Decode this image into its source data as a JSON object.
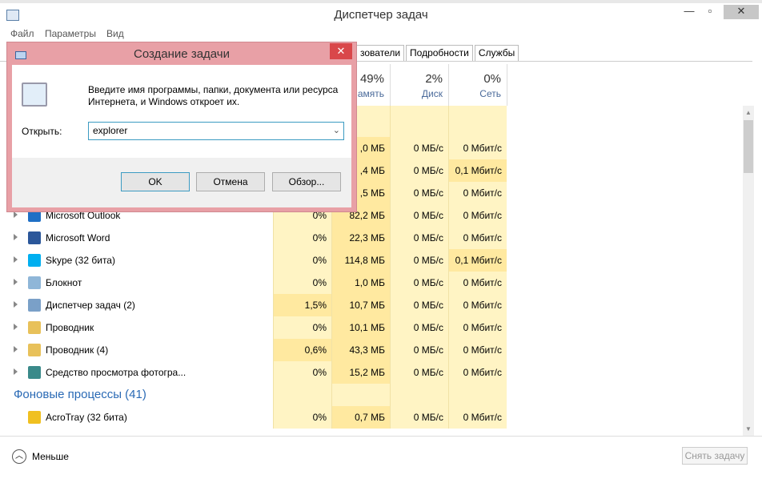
{
  "window": {
    "title": "Диспетчер задач",
    "minimize": "—",
    "maximize": "▫",
    "close": "✕"
  },
  "menu": [
    "Файл",
    "Параметры",
    "Вид"
  ],
  "tabs": [
    "зователи",
    "Подробности",
    "Службы"
  ],
  "columns": [
    {
      "pct": "",
      "label": ""
    },
    {
      "pct": "49%",
      "label": "амять"
    },
    {
      "pct": "2%",
      "label": "Диск"
    },
    {
      "pct": "0%",
      "label": "Сеть"
    }
  ],
  "rows": [
    {
      "name": "",
      "cpu": "",
      "mem": ",0 МБ",
      "disk": "0 МБ/с",
      "net": "0 Мбит/с"
    },
    {
      "name": "",
      "cpu": "",
      "mem": ",4 МБ",
      "disk": "0 МБ/с",
      "net": "0,1 Мбит/с"
    },
    {
      "name": "",
      "cpu": "",
      "mem": ",5 МБ",
      "disk": "0 МБ/с",
      "net": "0 Мбит/с"
    },
    {
      "name": "Microsoft Outlook",
      "cpu": "0%",
      "mem": "82,2 МБ",
      "disk": "0 МБ/с",
      "net": "0 Мбит/с",
      "color": "#1f6fc5"
    },
    {
      "name": "Microsoft Word",
      "cpu": "0%",
      "mem": "22,3 МБ",
      "disk": "0 МБ/с",
      "net": "0 Мбит/с",
      "color": "#2b579a"
    },
    {
      "name": "Skype (32 бита)",
      "cpu": "0%",
      "mem": "114,8 МБ",
      "disk": "0 МБ/с",
      "net": "0,1 Мбит/с",
      "color": "#00aff0"
    },
    {
      "name": "Блокнот",
      "cpu": "0%",
      "mem": "1,0 МБ",
      "disk": "0 МБ/с",
      "net": "0 Мбит/с",
      "color": "#8fb6d8"
    },
    {
      "name": "Диспетчер задач (2)",
      "cpu": "1,5%",
      "mem": "10,7 МБ",
      "disk": "0 МБ/с",
      "net": "0 Мбит/с",
      "color": "#7aa0c8"
    },
    {
      "name": "Проводник",
      "cpu": "0%",
      "mem": "10,1 МБ",
      "disk": "0 МБ/с",
      "net": "0 Мбит/с",
      "color": "#e8c15a"
    },
    {
      "name": "Проводник (4)",
      "cpu": "0,6%",
      "mem": "43,3 МБ",
      "disk": "0 МБ/с",
      "net": "0 Мбит/с",
      "color": "#e8c15a"
    },
    {
      "name": "Средство просмотра фотогра...",
      "cpu": "0%",
      "mem": "15,2 МБ",
      "disk": "0 МБ/с",
      "net": "0 Мбит/с",
      "color": "#3a8a8a"
    }
  ],
  "group": "Фоновые процессы (41)",
  "bg_rows": [
    {
      "name": "AcroTray (32 бита)",
      "cpu": "0%",
      "mem": "0,7 МБ",
      "disk": "0 МБ/с",
      "net": "0 Мбит/с",
      "color": "#f0c020"
    }
  ],
  "footer": {
    "less": "Меньше",
    "end_task": "Снять задачу"
  },
  "dialog": {
    "title": "Создание задачи",
    "close": "✕",
    "message": "Введите имя программы, папки, документа или ресурса Интернета, и Windows откроет их.",
    "open_label": "Открыть:",
    "open_value": "explorer",
    "ok": "OK",
    "cancel": "Отмена",
    "browse": "Обзор..."
  }
}
